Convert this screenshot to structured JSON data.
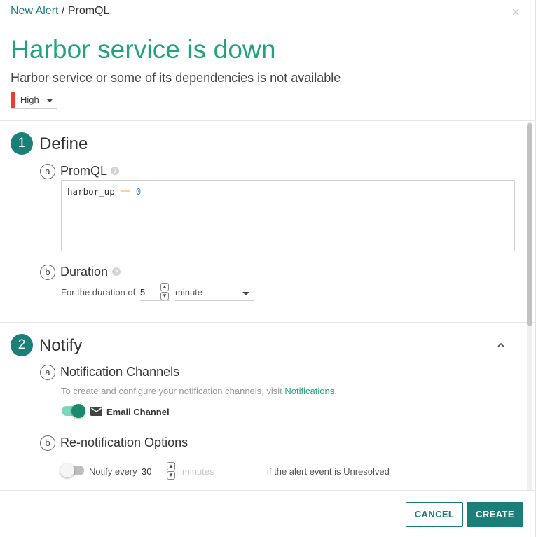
{
  "breadcrumb": {
    "link": "New Alert",
    "separator": " / ",
    "current": "PromQL"
  },
  "close_icon": "×",
  "alert": {
    "title": "Harbor service is down",
    "description": "Harbor service or some of its dependencies is not available",
    "severity": "High",
    "severity_color": "#ef3b32"
  },
  "define": {
    "number": "1",
    "title": "Define",
    "promql": {
      "letter": "a",
      "title": "PromQL",
      "query_tokens": {
        "ident": "harbor_up",
        "op": "==",
        "num": "0"
      }
    },
    "duration": {
      "letter": "b",
      "title": "Duration",
      "label": "For the duration of",
      "value": "5",
      "unit": "minute"
    }
  },
  "notify": {
    "number": "2",
    "title": "Notify",
    "channels": {
      "letter": "a",
      "title": "Notification Channels",
      "hint_prefix": "To create and configure your notification channels, visit ",
      "hint_link": "Notifications",
      "hint_suffix": ".",
      "email_label": "Email Channel",
      "email_enabled": true
    },
    "renotify": {
      "letter": "b",
      "title": "Re-notification Options",
      "enabled": false,
      "label": "Notify every",
      "value": "30",
      "unit_placeholder": "minutes",
      "suffix": "if the alert event is Unresolved"
    }
  },
  "footer": {
    "cancel_label": "CANCEL",
    "create_label": "CREATE"
  },
  "colors": {
    "accent": "#1a7e79",
    "title_green": "#21a37f"
  }
}
